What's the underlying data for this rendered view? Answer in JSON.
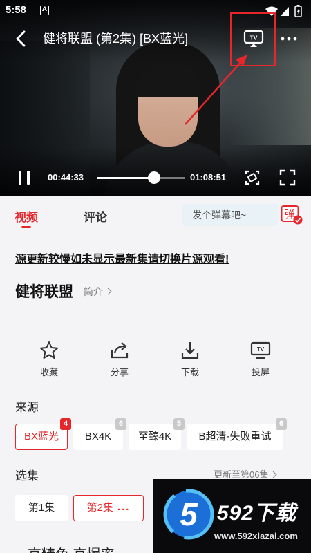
{
  "status_bar": {
    "time": "5:58",
    "notification": "A"
  },
  "player": {
    "title": "健将联盟 (第2集) [BX蓝光]",
    "current_time": "00:44:33",
    "total_time": "01:08:51",
    "progress": 0.65,
    "cast_label": "TV"
  },
  "tabs": [
    {
      "label": "视频",
      "active": true
    },
    {
      "label": "评论",
      "active": false
    }
  ],
  "danmaku": {
    "placeholder": "发个弹幕吧~",
    "toggle_label": "弹"
  },
  "notice": "源更新较慢如未显示最新集请切换片源观看!",
  "show": {
    "title": "健将联盟",
    "intro_label": "简介"
  },
  "actions": [
    {
      "label": "收藏",
      "icon": "star-icon"
    },
    {
      "label": "分享",
      "icon": "share-icon"
    },
    {
      "label": "下载",
      "icon": "download-icon"
    },
    {
      "label": "投屏",
      "icon": "cast-tv-icon"
    }
  ],
  "sources": {
    "title": "来源",
    "items": [
      {
        "label": "BX蓝光",
        "badge": "4",
        "active": true
      },
      {
        "label": "BX4K",
        "badge": "6",
        "active": false
      },
      {
        "label": "至臻4K",
        "badge": "5",
        "active": false
      },
      {
        "label": "B超清-失败重试",
        "badge": "6",
        "active": false
      }
    ]
  },
  "episodes": {
    "title": "选集",
    "update_note": "更新至第06集",
    "items": [
      {
        "label": "第1集",
        "active": false
      },
      {
        "label": "第2集",
        "active": true
      }
    ],
    "more_indicator": "..."
  },
  "bottom_partial": "高精色  高爆率",
  "watermark": {
    "logo_digit": "5",
    "name": "592下载",
    "url": "www.592xiazai.com"
  },
  "colors": {
    "accent": "#e5262b",
    "background": "#f4f4f6"
  }
}
